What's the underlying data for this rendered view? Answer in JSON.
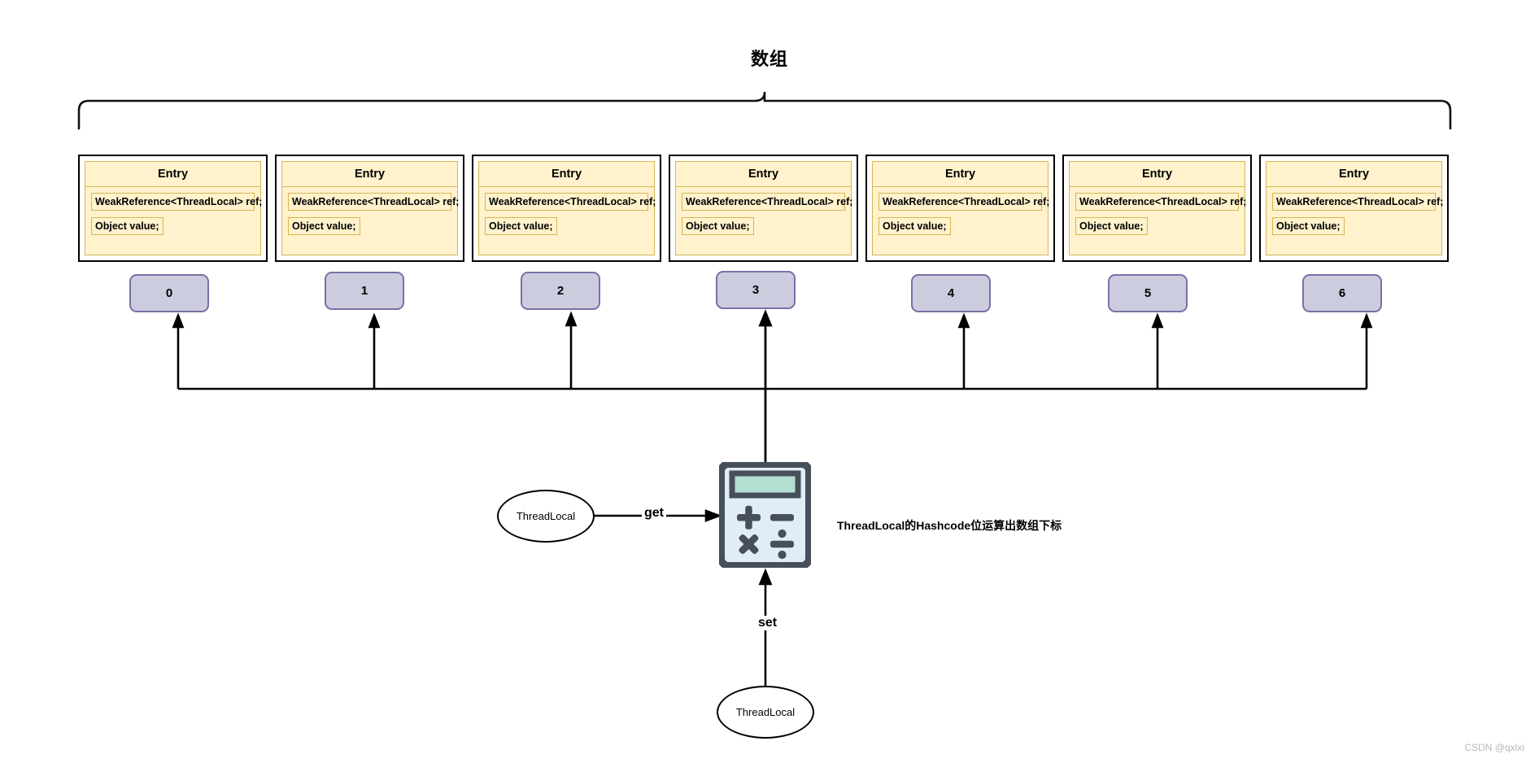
{
  "title": "数组",
  "entries": [
    {
      "header": "Entry",
      "ref_field": "WeakReference<ThreadLocal> ref;",
      "value_field": "Object value;"
    },
    {
      "header": "Entry",
      "ref_field": "WeakReference<ThreadLocal> ref;",
      "value_field": "Object value;"
    },
    {
      "header": "Entry",
      "ref_field": "WeakReference<ThreadLocal> ref;",
      "value_field": "Object value;"
    },
    {
      "header": "Entry",
      "ref_field": "WeakReference<ThreadLocal> ref;",
      "value_field": "Object value;"
    },
    {
      "header": "Entry",
      "ref_field": "WeakReference<ThreadLocal> ref;",
      "value_field": "Object value;"
    },
    {
      "header": "Entry",
      "ref_field": "WeakReference<ThreadLocal> ref;",
      "value_field": "Object value;"
    },
    {
      "header": "Entry",
      "ref_field": "WeakReference<ThreadLocal> ref;",
      "value_field": "Object value;"
    }
  ],
  "indices": [
    "0",
    "1",
    "2",
    "3",
    "4",
    "5",
    "6"
  ],
  "nodes": {
    "threadlocal_get": "ThreadLocal",
    "threadlocal_set": "ThreadLocal"
  },
  "edges": {
    "get_label": "get",
    "set_label": "set"
  },
  "annotation": "ThreadLocal的Hashcode位运算出数组下标",
  "calculator_icon": "calculator-icon",
  "watermark": "CSDN @qxlxi",
  "colors": {
    "entry_fill": "#fff2cc",
    "entry_stroke": "#d6b656",
    "index_fill": "#ccccdf",
    "index_stroke": "#7b6fa5",
    "line": "#000000",
    "calc_body": "#464f5a",
    "calc_screen": "#b3ded2",
    "calc_face": "#e0edf5"
  }
}
